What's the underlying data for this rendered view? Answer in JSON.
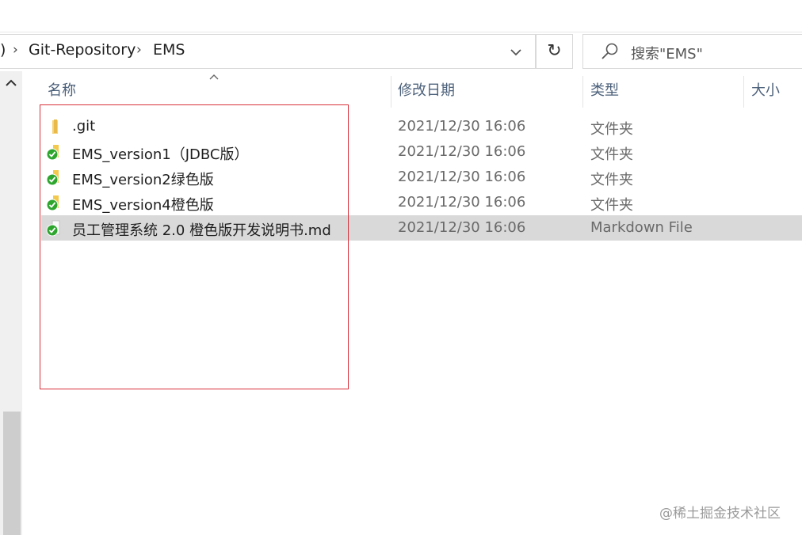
{
  "address": {
    "partial_crumb": ")",
    "crumbs": [
      "Git-Repository",
      "EMS"
    ],
    "dropdown_glyph": "⌄",
    "refresh_glyph": "↻"
  },
  "search": {
    "placeholder": "搜索\"EMS\""
  },
  "columns": {
    "name": "名称",
    "modified": "修改日期",
    "type": "类型",
    "size": "大小"
  },
  "files": [
    {
      "name": ".git",
      "modified": "2021/12/30 16:06",
      "type": "文件夹",
      "icon": "plain-folder-icon"
    },
    {
      "name": "EMS_version1（JDBC版）",
      "modified": "2021/12/30 16:06",
      "type": "文件夹",
      "icon": "git-synced-folder-icon"
    },
    {
      "name": "EMS_version2绿色版",
      "modified": "2021/12/30 16:06",
      "type": "文件夹",
      "icon": "git-synced-folder-icon"
    },
    {
      "name": "EMS_version4橙色版",
      "modified": "2021/12/30 16:06",
      "type": "文件夹",
      "icon": "git-synced-folder-icon"
    },
    {
      "name": "员工管理系统  2.0 橙色版开发说明书.md",
      "modified": "2021/12/30 16:06",
      "type": "Markdown File",
      "icon": "git-synced-file-icon",
      "selected": true
    }
  ],
  "watermark": "@稀土掘金技术社区",
  "colors": {
    "highlight_border": "#d9303a",
    "selected_row": "#d9d9d9",
    "header_text": "#4c607a",
    "status_ok": "#2ea62e",
    "folder": "#f2c94c"
  }
}
